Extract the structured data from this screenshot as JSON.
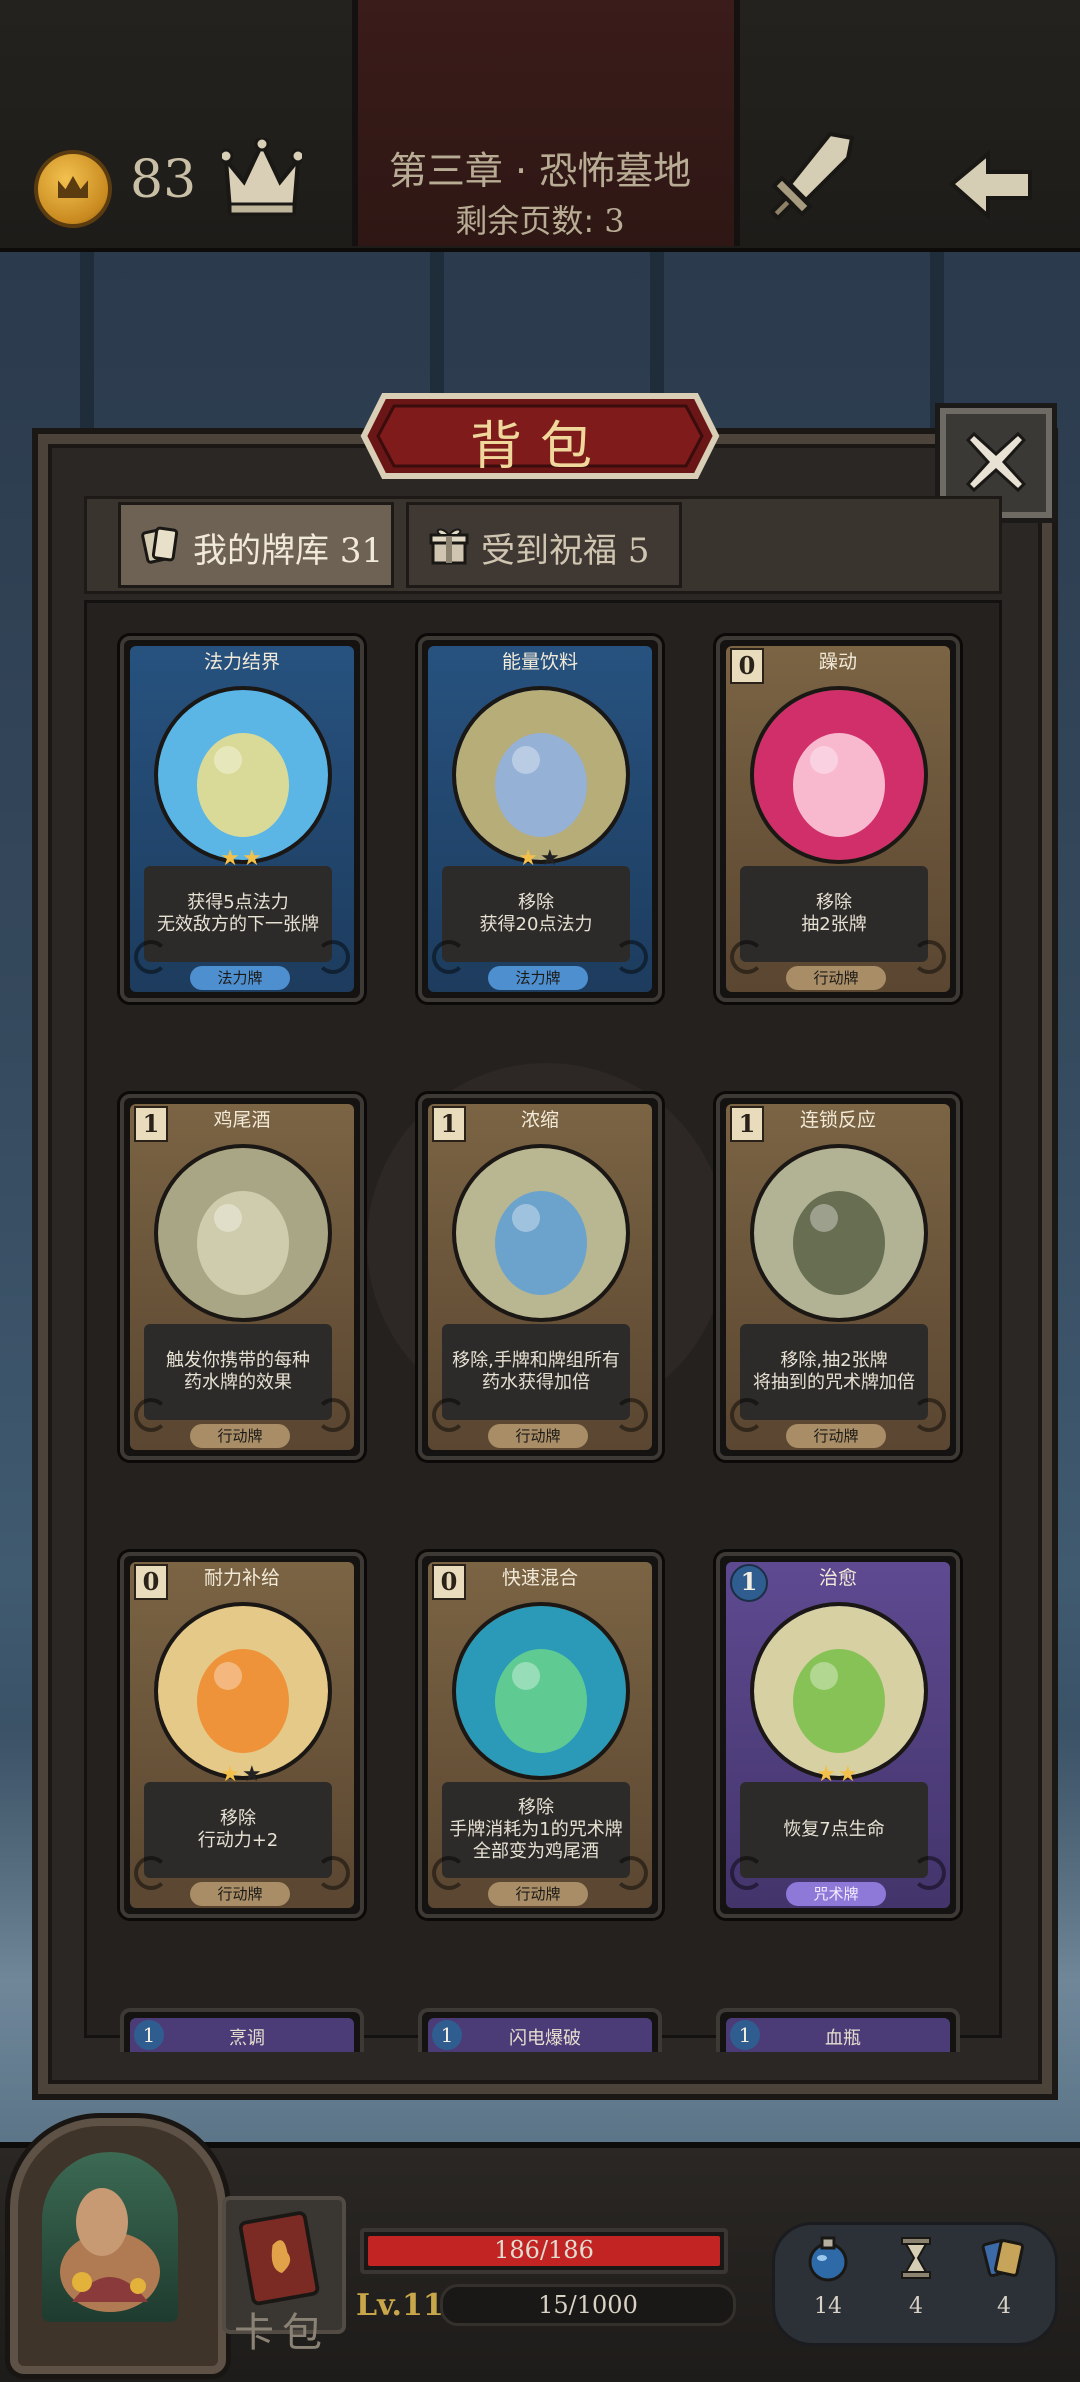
{
  "header": {
    "coins": "83",
    "chapter_title": "第三章 · 恐怖墓地",
    "pages_left_label": "剩余页数:",
    "pages_left_value": "3"
  },
  "backpack": {
    "title": "背包",
    "tabs": [
      {
        "label": "我的牌库",
        "count": "31",
        "active": true
      },
      {
        "label": "受到祝福",
        "count": "5",
        "active": false
      }
    ]
  },
  "cards": [
    {
      "name": "法力结界",
      "cost": "",
      "stars": 2,
      "max_stars": 2,
      "lines": [
        "获得5点法力",
        "无效敌方的下一张牌"
      ],
      "type": "法力牌",
      "frame": "blue"
    },
    {
      "name": "能量饮料",
      "cost": "",
      "stars": 1,
      "max_stars": 2,
      "lines": [
        "移除",
        "获得20点法力"
      ],
      "type": "法力牌",
      "frame": "blue"
    },
    {
      "name": "躁动",
      "cost": "0",
      "stars": 0,
      "max_stars": 0,
      "lines": [
        "移除",
        "抽2张牌"
      ],
      "type": "行动牌",
      "frame": "brown"
    },
    {
      "name": "鸡尾酒",
      "cost": "1",
      "stars": 0,
      "max_stars": 0,
      "lines": [
        "触发你携带的每种",
        "药水牌的效果"
      ],
      "type": "行动牌",
      "frame": "brown"
    },
    {
      "name": "浓缩",
      "cost": "1",
      "stars": 0,
      "max_stars": 0,
      "lines": [
        "移除,手牌和牌组所有",
        "药水获得加倍"
      ],
      "type": "行动牌",
      "frame": "brown"
    },
    {
      "name": "连锁反应",
      "cost": "1",
      "stars": 0,
      "max_stars": 0,
      "lines": [
        "移除,抽2张牌",
        "将抽到的咒术牌加倍"
      ],
      "type": "行动牌",
      "frame": "brown"
    },
    {
      "name": "耐力补给",
      "cost": "0",
      "stars": 1,
      "max_stars": 2,
      "lines": [
        "移除",
        "行动力+2"
      ],
      "type": "行动牌",
      "frame": "brown"
    },
    {
      "name": "快速混合",
      "cost": "0",
      "stars": 0,
      "max_stars": 0,
      "lines": [
        "移除",
        "手牌消耗为1的咒术牌",
        "全部变为鸡尾酒"
      ],
      "type": "行动牌",
      "frame": "brown"
    },
    {
      "name": "治愈",
      "cost": "1",
      "stars": 2,
      "max_stars": 2,
      "lines": [
        "恢复7点生命"
      ],
      "type": "咒术牌",
      "frame": "purple"
    }
  ],
  "peek_cards": [
    {
      "name": "烹调",
      "cost": "1"
    },
    {
      "name": "闪电爆破",
      "cost": "1"
    },
    {
      "name": "血瓶",
      "cost": "1"
    }
  ],
  "footer": {
    "cardpack_label": "卡包",
    "hp_text": "186/186",
    "hp_fraction": 1.0,
    "level": "Lv.11",
    "xp_text": "15/1000",
    "xp_fraction": 0.015,
    "resources": [
      {
        "icon": "potion-icon",
        "value": "14"
      },
      {
        "icon": "hourglass-icon",
        "value": "4"
      },
      {
        "icon": "card-stack-icon",
        "value": "4"
      }
    ]
  },
  "colors": {
    "highlight": "#f3c14b",
    "hp": "#c22424",
    "blue_frame": "#27527f",
    "brown_frame": "#7b6444",
    "purple_frame": "#5e4a91"
  }
}
